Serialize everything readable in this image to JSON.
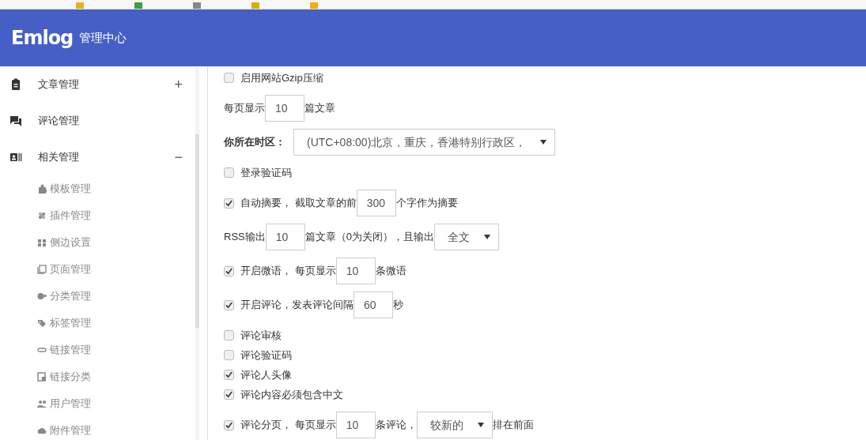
{
  "header": {
    "logo": "Emlog",
    "subtitle": "管理中心"
  },
  "sidebar": {
    "items": [
      {
        "label": "文章管理",
        "toggle": "+"
      },
      {
        "label": "评论管理"
      },
      {
        "label": "相关管理",
        "toggle": "−",
        "children": [
          {
            "label": "模板管理"
          },
          {
            "label": "插件管理"
          },
          {
            "label": "侧边设置"
          },
          {
            "label": "页面管理"
          },
          {
            "label": "分类管理"
          },
          {
            "label": "标签管理"
          },
          {
            "label": "链接管理"
          },
          {
            "label": "链接分类"
          },
          {
            "label": "用户管理"
          },
          {
            "label": "附件管理"
          }
        ]
      }
    ]
  },
  "settings": [
    {
      "checked": false,
      "parts": [
        {
          "kind": "text",
          "text": "启用网站Gzip压缩"
        }
      ]
    },
    {
      "parts": [
        {
          "kind": "text",
          "text": "每页显示"
        },
        {
          "kind": "input",
          "value": "10"
        },
        {
          "kind": "text",
          "text": "篇文章"
        }
      ]
    },
    {
      "parts": [
        {
          "kind": "text",
          "text": "你所在时区：",
          "bold": true
        },
        {
          "kind": "select",
          "value": "(UTC+08:00)北京，重庆，香港特别行政区，"
        }
      ]
    },
    {
      "checked": false,
      "parts": [
        {
          "kind": "text",
          "text": "登录验证码"
        }
      ]
    },
    {
      "checked": true,
      "parts": [
        {
          "kind": "text",
          "text": "自动摘要， 截取文章的前"
        },
        {
          "kind": "input",
          "value": "300"
        },
        {
          "kind": "text",
          "text": "个字作为摘要"
        }
      ]
    },
    {
      "parts": [
        {
          "kind": "text",
          "text": "RSS输出"
        },
        {
          "kind": "input",
          "value": "10"
        },
        {
          "kind": "text",
          "text": "篇文章（0为关闭），且输出"
        },
        {
          "kind": "select",
          "value": "全文"
        }
      ]
    },
    {
      "checked": true,
      "parts": [
        {
          "kind": "text",
          "text": "开启微语， 每页显示"
        },
        {
          "kind": "input",
          "value": "10"
        },
        {
          "kind": "text",
          "text": "条微语"
        }
      ]
    },
    {
      "checked": true,
      "parts": [
        {
          "kind": "text",
          "text": "开启评论，发表评论间隔"
        },
        {
          "kind": "input",
          "value": "60"
        },
        {
          "kind": "text",
          "text": "秒"
        }
      ]
    },
    {
      "checked": false,
      "parts": [
        {
          "kind": "text",
          "text": "评论审核"
        }
      ]
    },
    {
      "checked": false,
      "parts": [
        {
          "kind": "text",
          "text": "评论验证码"
        }
      ]
    },
    {
      "checked": true,
      "parts": [
        {
          "kind": "text",
          "text": "评论人头像"
        }
      ]
    },
    {
      "checked": true,
      "parts": [
        {
          "kind": "text",
          "text": "评论内容必须包含中文"
        }
      ]
    },
    {
      "checked": true,
      "parts": [
        {
          "kind": "text",
          "text": "评论分页， 每页显示"
        },
        {
          "kind": "input",
          "value": "10"
        },
        {
          "kind": "text",
          "text": "条评论，"
        },
        {
          "kind": "select",
          "value": "较新的"
        },
        {
          "kind": "text",
          "text": "排在前面"
        }
      ]
    }
  ]
}
